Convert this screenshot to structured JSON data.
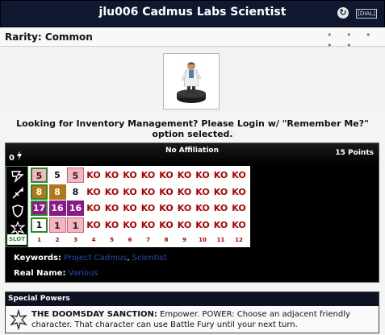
{
  "header": {
    "title": "jlu006 Cadmus Labs Scientist",
    "dial_label": "DIAL",
    "refresh_icon": "refresh-icon"
  },
  "rarity": {
    "label": "Rarity: Common",
    "dots": "• • • • •"
  },
  "notice": "Looking for Inventory Management? Please Login w/ \"Remember Me?\" option selected.",
  "dial": {
    "points_left": "0",
    "affiliation": "No Affiliation",
    "cost": "15 Points",
    "rows": [
      {
        "stat": "speed",
        "icon": "speed-icon",
        "values": [
          "5",
          "5",
          "5",
          "KO",
          "KO",
          "KO",
          "KO",
          "KO",
          "KO",
          "KO",
          "KO",
          "KO"
        ],
        "styles": [
          "pink",
          "white",
          "pink",
          "ko",
          "ko",
          "ko",
          "ko",
          "ko",
          "ko",
          "ko",
          "ko",
          "ko"
        ]
      },
      {
        "stat": "attack",
        "icon": "attack-icon",
        "values": [
          "8",
          "8",
          "8",
          "KO",
          "KO",
          "KO",
          "KO",
          "KO",
          "KO",
          "KO",
          "KO",
          "KO"
        ],
        "styles": [
          "gold",
          "gold",
          "white",
          "ko",
          "ko",
          "ko",
          "ko",
          "ko",
          "ko",
          "ko",
          "ko",
          "ko"
        ]
      },
      {
        "stat": "defense",
        "icon": "defense-icon",
        "values": [
          "17",
          "16",
          "16",
          "KO",
          "KO",
          "KO",
          "KO",
          "KO",
          "KO",
          "KO",
          "KO",
          "KO"
        ],
        "styles": [
          "purple",
          "purple",
          "purple",
          "ko",
          "ko",
          "ko",
          "ko",
          "ko",
          "ko",
          "ko",
          "ko",
          "ko"
        ]
      },
      {
        "stat": "damage",
        "icon": "damage-icon",
        "values": [
          "1",
          "1",
          "1",
          "KO",
          "KO",
          "KO",
          "KO",
          "KO",
          "KO",
          "KO",
          "KO",
          "KO"
        ],
        "styles": [
          "white",
          "pink",
          "pink",
          "ko",
          "ko",
          "ko",
          "ko",
          "ko",
          "ko",
          "ko",
          "ko",
          "ko"
        ]
      }
    ],
    "slot_label": "SLOT",
    "slots": [
      "1",
      "2",
      "3",
      "4",
      "5",
      "6",
      "7",
      "8",
      "9",
      "10",
      "11",
      "12"
    ]
  },
  "keywords": {
    "label": "Keywords:",
    "items": [
      "Project Cadmus",
      "Scientist"
    ]
  },
  "real_name": {
    "label": "Real Name:",
    "value": "Various"
  },
  "special_powers": {
    "heading": "Special Powers",
    "icon": "special-power-icon",
    "name": "THE DOOMSDAY SANCTION:",
    "text": "Empower. POWER: Choose an adjacent friendly character. That character can use Battle Fury until your next turn."
  },
  "colors": {
    "header_bg": "#0f1830",
    "ko_red": "#b00000",
    "pink": "#f4b5c0",
    "gold": "#b07818",
    "purple": "#8a1a8a",
    "link_blue": "#2a4bb0"
  }
}
